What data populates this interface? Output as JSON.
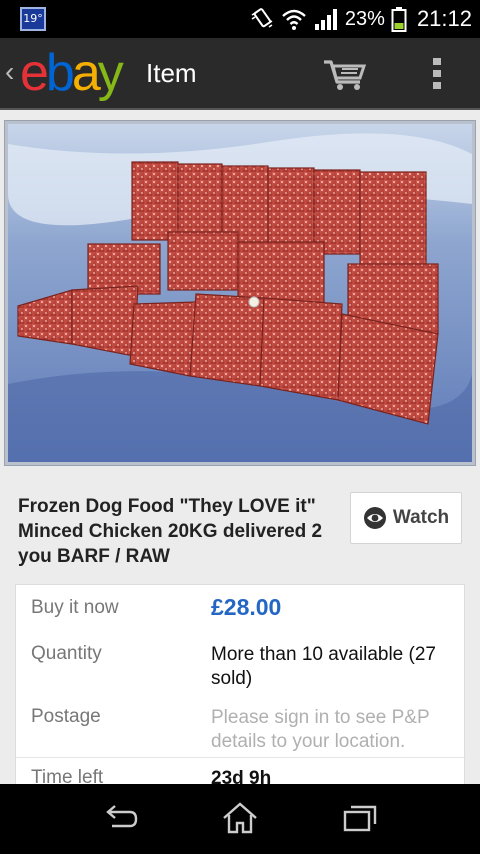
{
  "status_bar": {
    "weather_temp": "19°",
    "battery_percent": "23%",
    "time": "21:12",
    "icons": [
      "vibrate-icon",
      "wifi-icon",
      "signal-icon",
      "battery-icon"
    ]
  },
  "action_bar": {
    "back_glyph": "‹",
    "logo_letters": [
      "e",
      "b",
      "a",
      "y"
    ],
    "logo_colors": [
      "#e53238",
      "#0064d2",
      "#f5af02",
      "#86b817"
    ],
    "title": "Item",
    "icons": [
      "cart-icon",
      "overflow-menu-icon"
    ]
  },
  "item": {
    "title": "Frozen Dog Food \"They LOVE it\" Minced Chicken 20KG delivered 2 you BARF / RAW",
    "watch_label": "Watch",
    "image_alt": "product-photo"
  },
  "details": {
    "buy_label": "Buy it now",
    "price": "£28.00",
    "quantity_label": "Quantity",
    "quantity_value": "More than 10 available (27 sold)",
    "postage_label": "Postage",
    "postage_value": "Please sign in to see P&P details to your location.",
    "time_left_label": "Time left",
    "time_left_value": "23d 9h"
  },
  "nav_bar": {
    "icons": [
      "back-icon",
      "home-icon",
      "recent-apps-icon"
    ]
  },
  "colors": {
    "price": "#2366c4",
    "action_bar": "#2a2a2a",
    "content_bg": "#ececec"
  }
}
